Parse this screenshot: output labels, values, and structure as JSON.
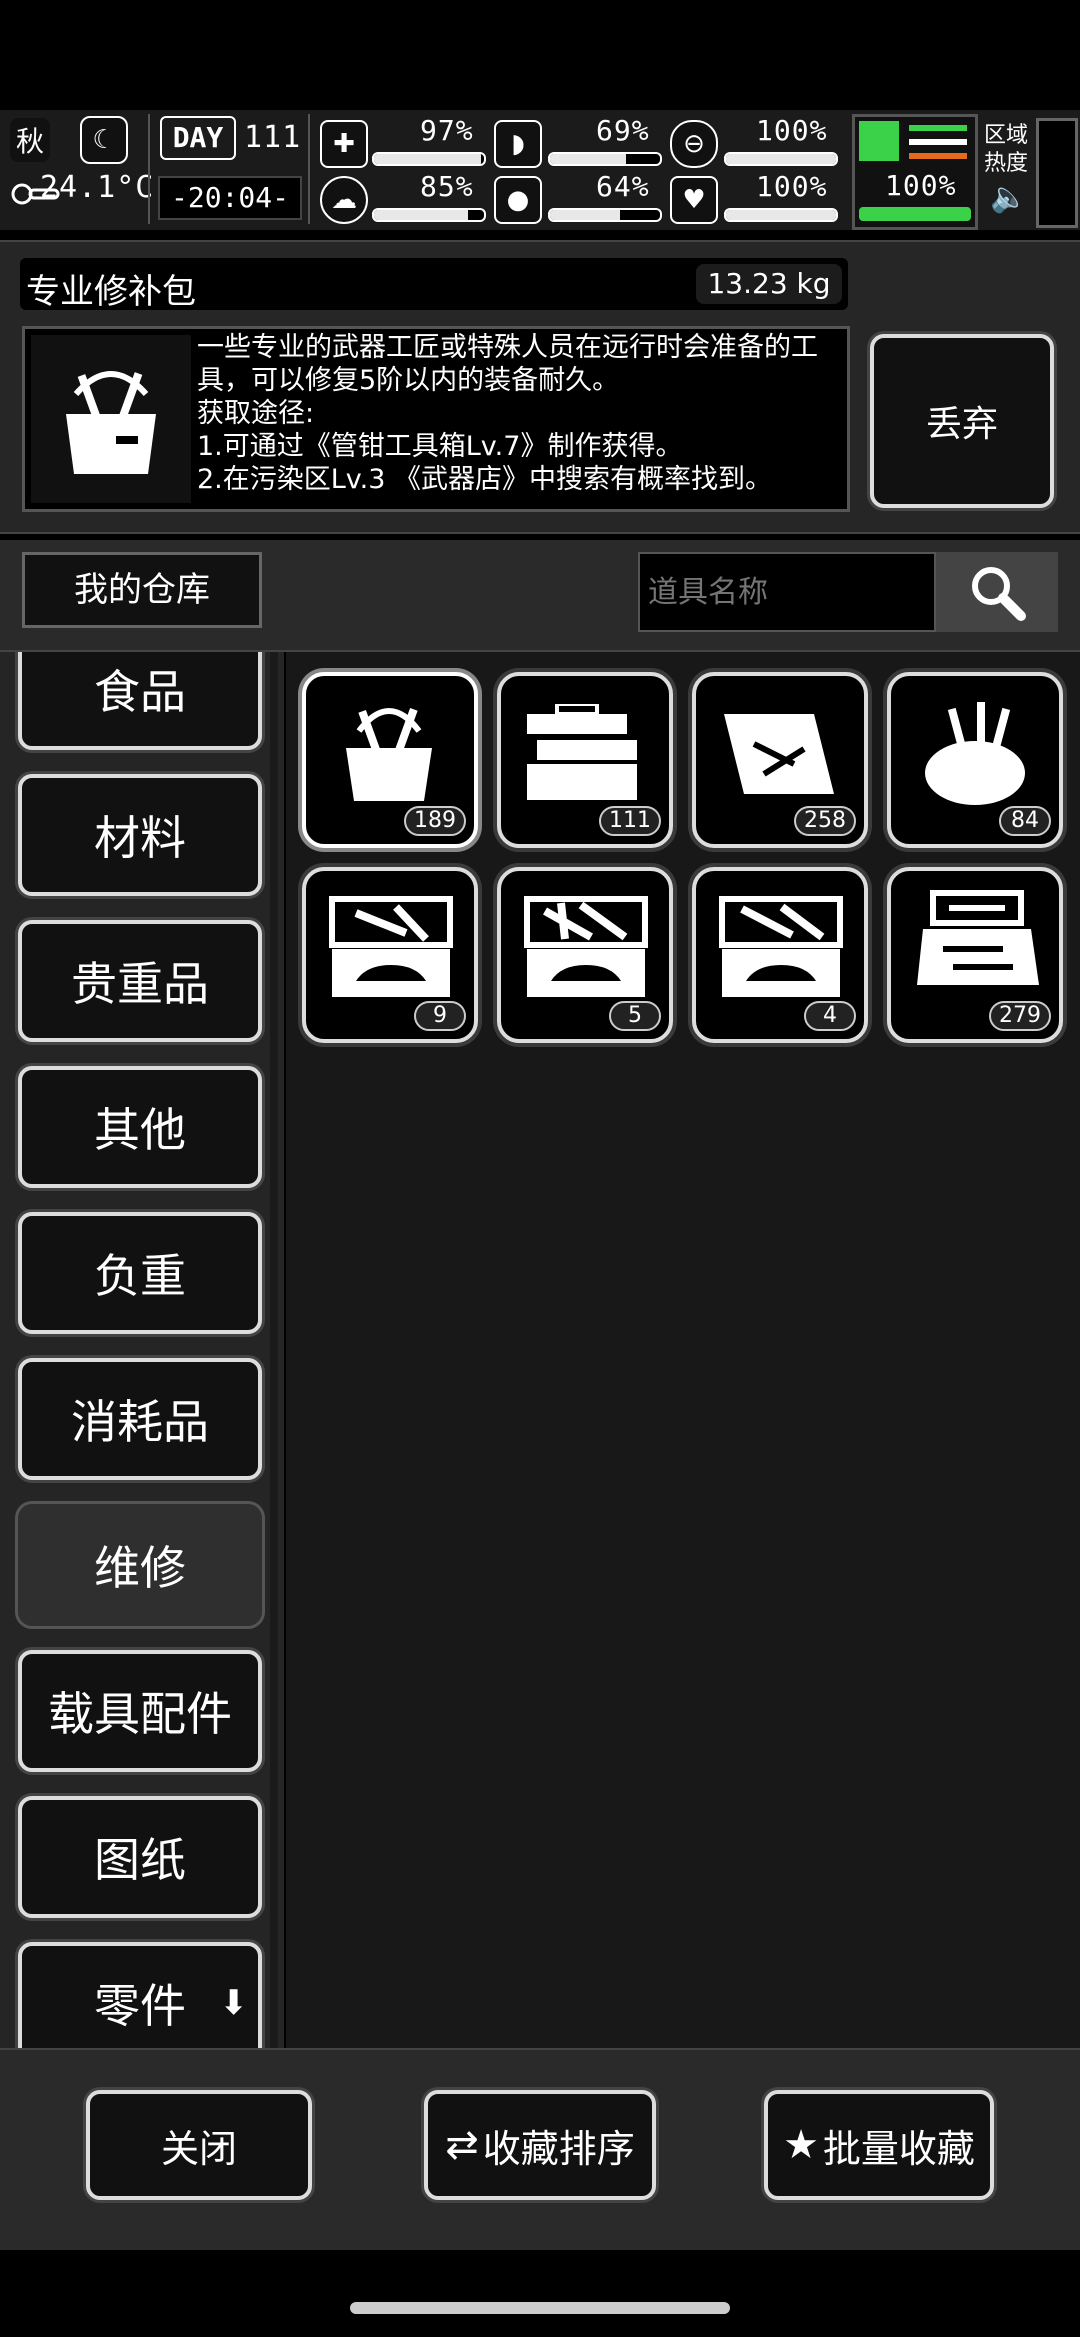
{
  "status": {
    "season": "秋",
    "temperature": "24.1°C",
    "day_label": "DAY",
    "day_count": "111",
    "time": "-20:04-",
    "health": "97%",
    "hunger": "69%",
    "stamina": "100%",
    "mood": "85%",
    "thirst": "64%",
    "heart": "100%",
    "speed": "100%",
    "region_label": "区域热度",
    "health_level": 0.97,
    "hunger_level": 0.69,
    "stamina_level": 1.0,
    "mood_level": 0.85,
    "thirst_level": 0.64,
    "heart_level": 1.0,
    "speed_level": 1.0
  },
  "item": {
    "name": "专业修补包",
    "weight": "13.23 kg",
    "description": "一些专业的武器工匠或特殊人员在远行时会准备的工具，可以修复5阶以内的装备耐久。",
    "obtain_title": "获取途径:",
    "obtain_1": "1.可通过《管钳工具箱Lv.7》制作获得。",
    "obtain_2": "2.在污染区Lv.3 《武器店》中搜索有概率找到。",
    "discard_label": "丢弃"
  },
  "storage": {
    "title": "我的仓库",
    "search_placeholder": "道具名称"
  },
  "categories": [
    "食品",
    "材料",
    "贵重品",
    "其他",
    "负重",
    "消耗品",
    "维修",
    "载具配件",
    "图纸",
    "零件"
  ],
  "active_category": "维修",
  "items": [
    {
      "icon": "repair-bag-icon",
      "count": "189"
    },
    {
      "icon": "toolbox-open-icon",
      "count": "111"
    },
    {
      "icon": "tool-case-icon",
      "count": "258"
    },
    {
      "icon": "tool-sack-icon",
      "count": "84"
    },
    {
      "icon": "car-toolbox-icon",
      "count": "9"
    },
    {
      "icon": "car-toolbox-icon",
      "count": "5"
    },
    {
      "icon": "car-toolbox-icon",
      "count": "4"
    },
    {
      "icon": "precision-kit-icon",
      "count": "279"
    }
  ],
  "bottom": {
    "close_label": "关闭",
    "sort_label": "收藏排序",
    "batch_label": "批量收藏"
  }
}
